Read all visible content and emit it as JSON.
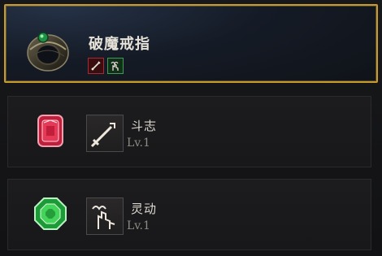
{
  "item": {
    "name": "破魔戒指",
    "icon": "ring-icon",
    "tags": [
      {
        "icon": "sword-icon",
        "color": "#a42b33"
      },
      {
        "icon": "dodge-hand-icon",
        "color": "#3f9a52"
      }
    ]
  },
  "skills": [
    {
      "gem_icon": "red-gem-icon",
      "gem_color": "#e03a55",
      "skill_icon": "sword-icon",
      "name": "斗志",
      "level": "Lv.1"
    },
    {
      "gem_icon": "green-gem-icon",
      "gem_color": "#3fcf4f",
      "skill_icon": "dodge-hand-icon",
      "name": "灵动",
      "level": "Lv.1"
    }
  ],
  "colors": {
    "selected_border": "#c79a2a",
    "background": "#141416"
  }
}
